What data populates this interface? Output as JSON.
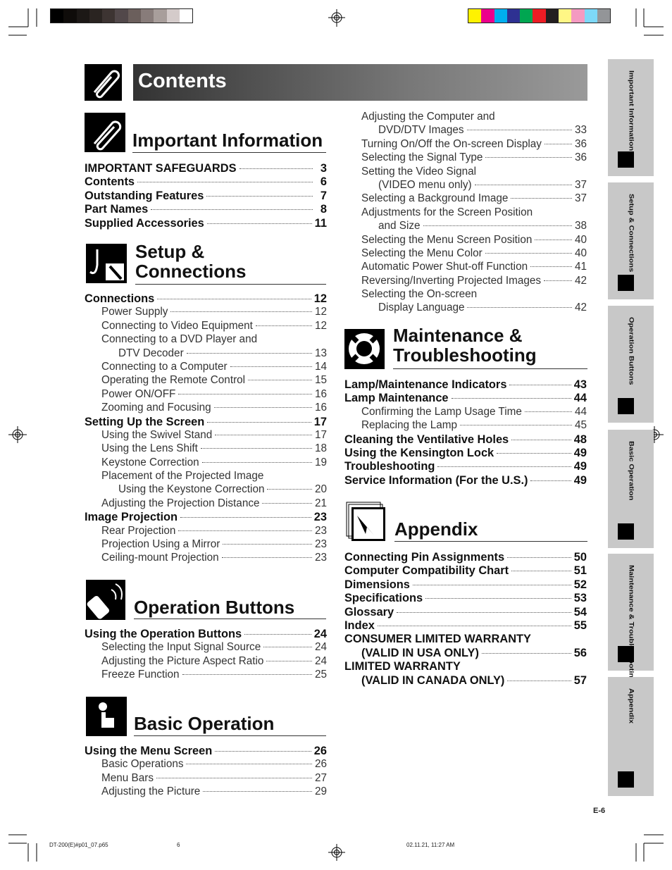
{
  "header": {
    "title": "Contents"
  },
  "color_bars": {
    "gray": [
      "#000000",
      "#0f0c0a",
      "#1c1816",
      "#2a2421",
      "#3d3432",
      "#52484a",
      "#6b5f5c",
      "#887c7a",
      "#a89e9b",
      "#d4cbca",
      "#ffffff"
    ],
    "color": [
      "#fff200",
      "#ec008c",
      "#00aeef",
      "#2e3192",
      "#00a651",
      "#ed1c24",
      "#231f20",
      "#fff685",
      "#f49ac1",
      "#7dd8f8",
      "#939598"
    ]
  },
  "sections": {
    "important": {
      "title": "Important Information",
      "icon": "paperclip-icon",
      "entries": [
        {
          "level": 0,
          "text": "IMPORTANT SAFEGUARDS",
          "page": "3"
        },
        {
          "level": 0,
          "text": "Contents",
          "page": "6"
        },
        {
          "level": 0,
          "text": "Outstanding Features",
          "page": "7"
        },
        {
          "level": 0,
          "text": "Part Names",
          "page": "8"
        },
        {
          "level": 0,
          "text": "Supplied Accessories",
          "page": "11"
        }
      ]
    },
    "setup": {
      "title_line1": "Setup &",
      "title_line2": "Connections",
      "icon": "connector-icon",
      "entries": [
        {
          "level": 0,
          "text": "Connections",
          "page": "12"
        },
        {
          "level": 1,
          "text": "Power Supply",
          "page": "12"
        },
        {
          "level": 1,
          "text": "Connecting to Video Equipment",
          "page": "12"
        },
        {
          "level": 1,
          "text": "Connecting to a DVD Player and",
          "page": ""
        },
        {
          "level": 2,
          "text": "DTV Decoder",
          "page": "13"
        },
        {
          "level": 1,
          "text": "Connecting to a Computer",
          "page": "14"
        },
        {
          "level": 1,
          "text": "Operating the Remote Control",
          "page": "15"
        },
        {
          "level": 1,
          "text": "Power ON/OFF",
          "page": "16"
        },
        {
          "level": 1,
          "text": "Zooming and Focusing",
          "page": "16"
        },
        {
          "level": 0,
          "text": "Setting Up the Screen",
          "page": "17"
        },
        {
          "level": 1,
          "text": "Using the Swivel Stand",
          "page": "17"
        },
        {
          "level": 1,
          "text": "Using the Lens Shift",
          "page": "18"
        },
        {
          "level": 1,
          "text": "Keystone Correction",
          "page": "19"
        },
        {
          "level": 1,
          "text": "Placement of the Projected Image",
          "page": ""
        },
        {
          "level": 2,
          "text": "Using the Keystone Correction",
          "page": "20"
        },
        {
          "level": 1,
          "text": "Adjusting the Projection Distance",
          "page": "21"
        },
        {
          "level": 0,
          "text": "Image Projection",
          "page": "23"
        },
        {
          "level": 1,
          "text": "Rear Projection",
          "page": "23"
        },
        {
          "level": 1,
          "text": "Projection Using a Mirror",
          "page": "23"
        },
        {
          "level": 1,
          "text": "Ceiling-mount Projection",
          "page": "23"
        }
      ]
    },
    "operation": {
      "title": "Operation Buttons",
      "icon": "remote-control-icon",
      "entries": [
        {
          "level": 0,
          "text": "Using the Operation Buttons",
          "page": "24"
        },
        {
          "level": 1,
          "text": "Selecting the Input Signal Source",
          "page": "24"
        },
        {
          "level": 1,
          "text": "Adjusting the Picture Aspect Ratio",
          "page": "24"
        },
        {
          "level": 1,
          "text": "Freeze Function",
          "page": "25"
        }
      ]
    },
    "basic": {
      "title": "Basic Operation",
      "icon": "pointing-hand-icon",
      "entries": [
        {
          "level": 0,
          "text": "Using the Menu Screen",
          "page": "26"
        },
        {
          "level": 1,
          "text": "Basic Operations",
          "page": "26"
        },
        {
          "level": 1,
          "text": "Menu Bars",
          "page": "27"
        },
        {
          "level": 1,
          "text": "Adjusting the Picture",
          "page": "29"
        }
      ]
    },
    "basic_cont": {
      "entries": [
        {
          "level": 1,
          "text": "Adjusting the Computer and",
          "page": ""
        },
        {
          "level": 2,
          "text": "DVD/DTV Images",
          "page": "33"
        },
        {
          "level": 1,
          "text": "Turning On/Off the On-screen Display",
          "page": "36"
        },
        {
          "level": 1,
          "text": "Selecting the Signal Type",
          "page": "36"
        },
        {
          "level": 1,
          "text": "Setting the Video Signal",
          "page": ""
        },
        {
          "level": 2,
          "text": "(VIDEO menu only)",
          "page": "37"
        },
        {
          "level": 1,
          "text": "Selecting a Background Image",
          "page": "37"
        },
        {
          "level": 1,
          "text": "Adjustments for the Screen Position",
          "page": ""
        },
        {
          "level": 2,
          "text": "and Size",
          "page": "38"
        },
        {
          "level": 1,
          "text": "Selecting the Menu Screen Position",
          "page": "40"
        },
        {
          "level": 1,
          "text": "Selecting the Menu Color",
          "page": "40"
        },
        {
          "level": 1,
          "text": "Automatic Power Shut-off Function",
          "page": "41"
        },
        {
          "level": 1,
          "text": "Reversing/Inverting Projected Images",
          "page": "42"
        },
        {
          "level": 1,
          "text": "Selecting the On-screen",
          "page": ""
        },
        {
          "level": 2,
          "text": "Display Language",
          "page": "42"
        }
      ]
    },
    "maintenance": {
      "title_line1": "Maintenance &",
      "title_line2": "Troubleshooting",
      "icon": "lifebuoy-icon",
      "entries": [
        {
          "level": 0,
          "text": "Lamp/Maintenance Indicators",
          "page": "43"
        },
        {
          "level": 0,
          "text": "Lamp Maintenance",
          "page": "44"
        },
        {
          "level": 1,
          "text": "Confirming the Lamp Usage Time",
          "page": "44"
        },
        {
          "level": 1,
          "text": "Replacing the Lamp",
          "page": "45"
        },
        {
          "level": 0,
          "text": "Cleaning the Ventilative Holes",
          "page": "48"
        },
        {
          "level": 0,
          "text": "Using the Kensington Lock",
          "page": "49"
        },
        {
          "level": 0,
          "text": "Troubleshooting",
          "page": "49"
        },
        {
          "level": 0,
          "text": "Service Information (For the U.S.)",
          "page": "49"
        }
      ]
    },
    "appendix": {
      "title": "Appendix",
      "icon": "document-arrow-icon",
      "entries": [
        {
          "level": 0,
          "text": "Connecting Pin Assignments",
          "page": "50"
        },
        {
          "level": 0,
          "text": "Computer Compatibility Chart",
          "page": "51"
        },
        {
          "level": 0,
          "text": "Dimensions",
          "page": "52"
        },
        {
          "level": 0,
          "text": "Specifications",
          "page": "53"
        },
        {
          "level": 0,
          "text": "Glossary",
          "page": "54"
        },
        {
          "level": 0,
          "text": "Index",
          "page": "55"
        },
        {
          "level": 0,
          "text": "CONSUMER LIMITED WARRANTY",
          "page": ""
        },
        {
          "level": 1,
          "text": "(VALID IN USA ONLY)",
          "page": "56",
          "bold": true
        },
        {
          "level": 0,
          "text": "LIMITED WARRANTY",
          "page": ""
        },
        {
          "level": 1,
          "text": "(VALID IN CANADA ONLY)",
          "page": "57",
          "bold": true
        }
      ]
    }
  },
  "side_tabs": [
    {
      "label": "Important Information",
      "icon": "paperclip-icon"
    },
    {
      "label": "Setup & Connections",
      "icon": "connector-icon"
    },
    {
      "label": "Operation Buttons",
      "icon": "remote-control-icon"
    },
    {
      "label": "Basic Operation",
      "icon": "pointing-hand-icon"
    },
    {
      "label": "Maintenance & Troubleshooting",
      "icon": "lifebuoy-icon"
    },
    {
      "label": "Appendix",
      "icon": "document-arrow-icon"
    }
  ],
  "footer": {
    "page_number": "E-6",
    "file": "DT-200(E)#p01_07.p65",
    "sheet": "6",
    "timestamp": "02.11.21, 11:27 AM"
  }
}
